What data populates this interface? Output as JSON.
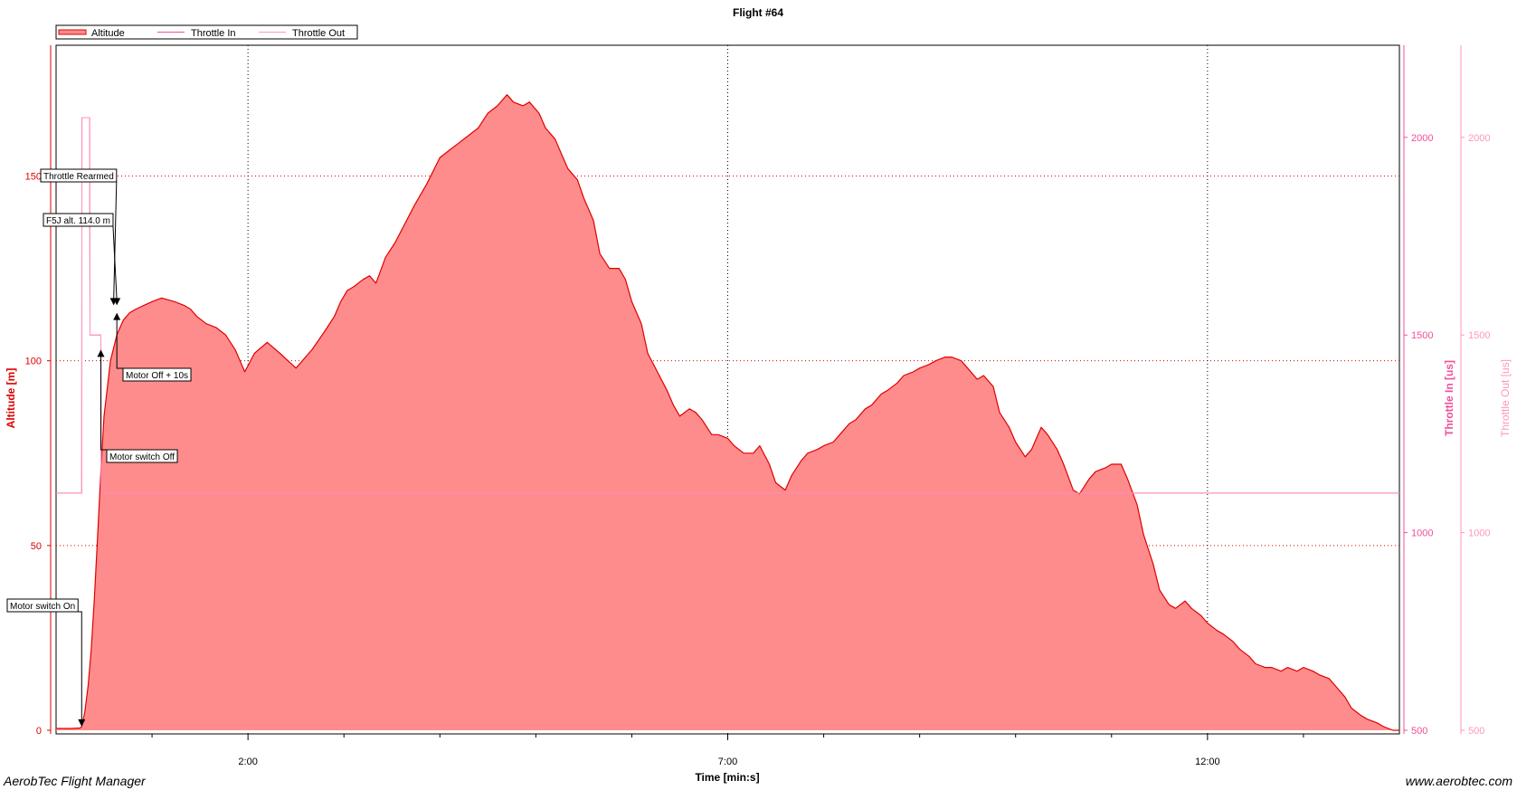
{
  "footer": {
    "app_name": "AerobTec Flight Manager",
    "website": "www.aerobtec.com"
  },
  "chart_data": {
    "type": "area",
    "title": "Flight #64",
    "xlabel": "Time [min:s]",
    "ylabel_left": "Altitude [m]",
    "ylabel_right_1": "Throttle In [us]",
    "ylabel_right_2": "Throttle Out [us]",
    "x_unit": "seconds",
    "xlim": [
      0,
      840
    ],
    "x_ticks": [
      {
        "value": 120,
        "label": "2:00"
      },
      {
        "value": 420,
        "label": "7:00"
      },
      {
        "value": 720,
        "label": "12:00"
      }
    ],
    "x_minor_ticks": [
      60,
      180,
      240,
      300,
      360,
      480,
      540,
      600,
      660,
      780
    ],
    "ylim_left": [
      0,
      180
    ],
    "y_ticks_left": [
      {
        "value": 0,
        "label": "0"
      },
      {
        "value": 50,
        "label": "50"
      },
      {
        "value": 100,
        "label": "100"
      },
      {
        "value": 150,
        "label": "150"
      }
    ],
    "ylim_right": [
      500,
      2027
    ],
    "y_ticks_right": [
      {
        "value": 500,
        "label": "500"
      },
      {
        "value": 1000,
        "label": "1000"
      },
      {
        "value": 1500,
        "label": "1500"
      },
      {
        "value": 2000,
        "label": "2000"
      }
    ],
    "grid": true,
    "legend_position": "top-left",
    "colors": {
      "altitude_line": "#e00000",
      "altitude_fill": "#ff8c8c",
      "throttle_in": "#f0509a",
      "throttle_out": "#ff96bf",
      "grid_major": "#e00000",
      "grid_minor": "#000000",
      "right_axis_1": "#f0509a",
      "right_axis_2": "#ff96bf"
    },
    "series": [
      {
        "name": "Altitude",
        "axis": "left",
        "x": [
          0,
          10,
          15,
          16,
          18,
          20,
          22,
          24,
          26,
          28,
          30,
          34,
          38,
          42,
          46,
          50,
          55,
          60,
          66,
          74,
          80,
          84,
          88,
          94,
          100,
          106,
          112,
          118,
          124,
          132,
          140,
          150,
          160,
          168,
          174,
          178,
          182,
          186,
          192,
          196,
          200,
          206,
          212,
          218,
          224,
          232,
          240,
          246,
          252,
          258,
          264,
          270,
          276,
          282,
          286,
          292,
          296,
          302,
          306,
          312,
          316,
          320,
          326,
          330,
          336,
          340,
          346,
          352,
          356,
          360,
          366,
          370,
          376,
          382,
          386,
          390,
          396,
          400,
          404,
          410,
          414,
          420,
          424,
          430,
          436,
          440,
          446,
          450,
          456,
          460,
          466,
          470,
          476,
          480,
          486,
          490,
          496,
          500,
          506,
          510,
          516,
          520,
          526,
          530,
          536,
          540,
          546,
          550,
          556,
          560,
          566,
          570,
          576,
          580,
          586,
          590,
          596,
          600,
          606,
          610,
          616,
          620,
          626,
          630,
          636,
          640,
          646,
          650,
          656,
          660,
          666,
          670,
          676,
          680,
          686,
          690,
          696,
          700,
          706,
          710,
          716,
          720,
          726,
          730,
          736,
          740,
          746,
          750,
          756,
          760,
          766,
          770,
          776,
          780,
          786,
          790,
          796,
          800,
          806,
          810,
          816,
          820,
          826,
          830,
          836,
          840
        ],
        "values": [
          0.5,
          0.5,
          0.6,
          1,
          5,
          12,
          22,
          36,
          53,
          70,
          85,
          100,
          107,
          111,
          113,
          114,
          115,
          116,
          117,
          116,
          115,
          114,
          112,
          110,
          109,
          107,
          103,
          97,
          102,
          105,
          102,
          98,
          103,
          108,
          112,
          116,
          119,
          120,
          122,
          123,
          121,
          128,
          132,
          137,
          142,
          148,
          155,
          157,
          159,
          161,
          163,
          167,
          169,
          172,
          170,
          169,
          170,
          167,
          163,
          160,
          156,
          152,
          149,
          144,
          138,
          129,
          125,
          125,
          122,
          116,
          110,
          102,
          97,
          92,
          88,
          85,
          87,
          86,
          84,
          80,
          80,
          79,
          77,
          75,
          75,
          77,
          72,
          67,
          65,
          69,
          73,
          75,
          76,
          77,
          78,
          80,
          83,
          84,
          87,
          88,
          91,
          92,
          94,
          96,
          97,
          98,
          99,
          100,
          101,
          101,
          100,
          98,
          95,
          96,
          93,
          86,
          82,
          78,
          74,
          76,
          82,
          80,
          76,
          72,
          65,
          64,
          68,
          70,
          71,
          72,
          72,
          68,
          61,
          53,
          45,
          38,
          34,
          33,
          35,
          33,
          31,
          29,
          27,
          26,
          24,
          22,
          20,
          18,
          17,
          17,
          16,
          17,
          16,
          17,
          16,
          15,
          14,
          12,
          9,
          6,
          4,
          3,
          2,
          1,
          0,
          0
        ]
      },
      {
        "name": "Throttle In",
        "axis": "right",
        "x": [
          0,
          16,
          16.2,
          21,
          21.2,
          28,
          28.2,
          840
        ],
        "values": [
          1100,
          1100,
          2050,
          2050,
          1500,
          1500,
          1100,
          1100
        ]
      },
      {
        "name": "Throttle Out",
        "axis": "right",
        "x": [
          0,
          16,
          16.2,
          21,
          21.2,
          28,
          28.2,
          840
        ],
        "values": [
          1100,
          1100,
          2050,
          2050,
          1500,
          1500,
          1100,
          1100
        ]
      }
    ],
    "annotations": [
      {
        "label": "Motor switch On",
        "x": 16,
        "y": 1,
        "arrow": "down"
      },
      {
        "label": "Motor switch Off",
        "x": 28,
        "y": 103,
        "arrow": "up"
      },
      {
        "label": "Throttle Rearmed",
        "x": 36,
        "y": 115,
        "arrow": "down"
      },
      {
        "label": "F5J alt. 114.0 m",
        "x": 38,
        "y": 115,
        "arrow": "down"
      },
      {
        "label": "Motor Off + 10s",
        "x": 38,
        "y": 113,
        "arrow": "up"
      }
    ]
  }
}
